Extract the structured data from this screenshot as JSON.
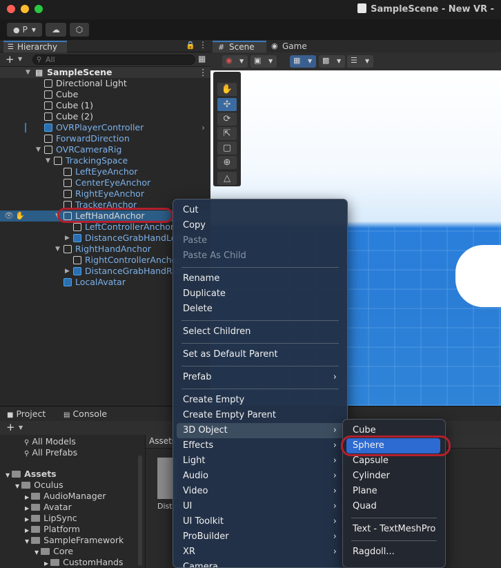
{
  "window": {
    "title": "SampleScene - New VR -"
  },
  "toolbar": {
    "account_label": "P"
  },
  "hierarchy": {
    "tab_label": "Hierarchy",
    "search_placeholder": "All",
    "scene_name": "SampleScene",
    "rows": [
      {
        "label": "Directional Light",
        "color": "white"
      },
      {
        "label": "Cube",
        "color": "white"
      },
      {
        "label": "Cube (1)",
        "color": "white"
      },
      {
        "label": "Cube (2)",
        "color": "white"
      },
      {
        "label": "OVRPlayerController",
        "color": "blue"
      },
      {
        "label": "ForwardDirection",
        "color": "blue"
      },
      {
        "label": "OVRCameraRig",
        "color": "blue"
      },
      {
        "label": "TrackingSpace",
        "color": "blue"
      },
      {
        "label": "LeftEyeAnchor",
        "color": "blue"
      },
      {
        "label": "CenterEyeAnchor",
        "color": "blue"
      },
      {
        "label": "RightEyeAnchor",
        "color": "blue"
      },
      {
        "label": "TrackerAnchor",
        "color": "blue"
      },
      {
        "label": "LeftHandAnchor",
        "color": "white"
      },
      {
        "label": "LeftControllerAnchor",
        "color": "blue"
      },
      {
        "label": "DistanceGrabHandLeft",
        "color": "blue"
      },
      {
        "label": "RightHandAnchor",
        "color": "blue"
      },
      {
        "label": "RightControllerAnchor",
        "color": "blue"
      },
      {
        "label": "DistanceGrabHandRight",
        "color": "blue"
      },
      {
        "label": "LocalAvatar",
        "color": "blue"
      }
    ]
  },
  "scene": {
    "scene_tab": "Scene",
    "game_tab": "Game"
  },
  "bottom": {
    "project_tab": "Project",
    "console_tab": "Console",
    "breadcrumb": "Assets",
    "asset_item": "Dista",
    "favorites": [
      "All Models",
      "All Prefabs"
    ],
    "tree": [
      "Assets",
      "Oculus",
      "AudioManager",
      "Avatar",
      "LipSync",
      "Platform",
      "SampleFramework",
      "Core",
      "CustomHands"
    ]
  },
  "context_menu": {
    "items": [
      "Cut",
      "Copy",
      "Paste",
      "Paste As Child",
      "Rename",
      "Duplicate",
      "Delete",
      "Select Children",
      "Set as Default Parent",
      "Prefab",
      "Create Empty",
      "Create Empty Parent",
      "3D Object",
      "Effects",
      "Light",
      "Audio",
      "Video",
      "UI",
      "UI Toolkit",
      "ProBuilder",
      "XR",
      "Camera"
    ]
  },
  "submenu_3d": {
    "items": [
      "Cube",
      "Sphere",
      "Capsule",
      "Cylinder",
      "Plane",
      "Quad",
      "Text - TextMeshPro",
      "Ragdoll..."
    ]
  },
  "colors": {
    "accent": "#3a79bb",
    "highlight_ring": "#b3202e",
    "menu_selected": "#2d6ad2",
    "row_selected": "#2c5d87"
  }
}
